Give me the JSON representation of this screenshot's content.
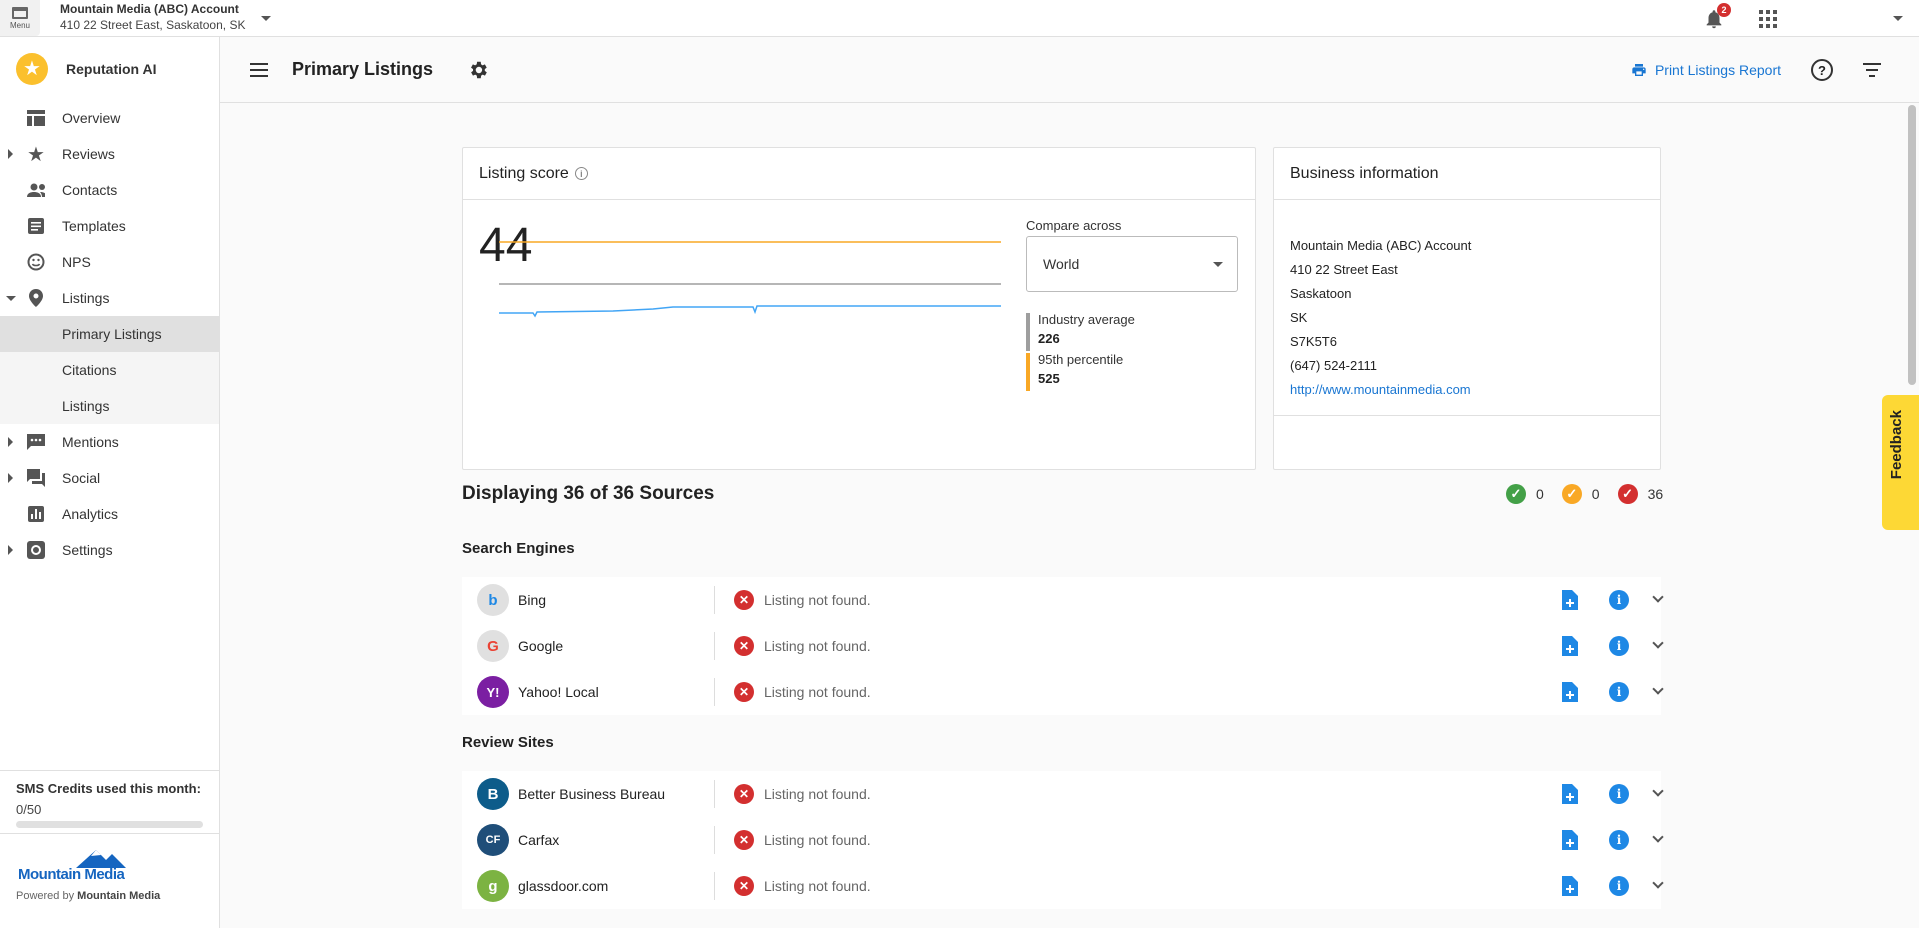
{
  "topbar": {
    "menu_label": "Menu",
    "account_name": "Mountain Media (ABC) Account",
    "account_address": "410 22 Street East, Saskatoon, SK",
    "notification_count": "2"
  },
  "sidebar": {
    "brand": "Reputation AI",
    "items": [
      {
        "label": "Overview",
        "icon": "dashboard-icon"
      },
      {
        "label": "Reviews",
        "icon": "star-icon"
      },
      {
        "label": "Contacts",
        "icon": "people-icon"
      },
      {
        "label": "Templates",
        "icon": "template-icon"
      },
      {
        "label": "NPS",
        "icon": "smiley-icon"
      },
      {
        "label": "Listings",
        "icon": "location-pin-icon"
      },
      {
        "label": "Primary Listings"
      },
      {
        "label": "Citations"
      },
      {
        "label": "Listings"
      },
      {
        "label": "Mentions",
        "icon": "chat-icon"
      },
      {
        "label": "Social",
        "icon": "forum-icon"
      },
      {
        "label": "Analytics",
        "icon": "bar-chart-icon"
      },
      {
        "label": "Settings",
        "icon": "settings-icon"
      }
    ],
    "sms_title": "SMS Credits used this month:",
    "sms_value": "0/50",
    "sms_fraction": 0,
    "footer_logo": "Mountain Media",
    "powered_prefix": "Powered by",
    "powered_brand": "Mountain Media"
  },
  "header": {
    "title": "Primary Listings",
    "print_label": "Print Listings Report"
  },
  "listing_score": {
    "title": "Listing score",
    "score": "44",
    "compare_label": "Compare across",
    "compare_value": "World",
    "legend": [
      {
        "name": "Industry average",
        "value": "226",
        "color": "#9e9e9e"
      },
      {
        "name": "95th percentile",
        "value": "525",
        "color": "#f9a825"
      }
    ]
  },
  "business": {
    "title": "Business information",
    "name": "Mountain Media (ABC) Account",
    "street": "410 22 Street East",
    "city": "Saskatoon",
    "province": "SK",
    "postal": "S7K5T6",
    "phone": "(647) 524-2111",
    "website": "http://www.mountainmedia.com"
  },
  "summary": {
    "displaying": "Displaying 36 of 36 Sources",
    "green_count": "0",
    "yellow_count": "0",
    "red_count": "36"
  },
  "sections": [
    {
      "title": "Search Engines",
      "rows": [
        {
          "name": "Bing",
          "status": "Listing not found.",
          "logo_letter": "b",
          "logo_color": "#e0e0e0",
          "logo_text_color": "#1e88e5"
        },
        {
          "name": "Google",
          "status": "Listing not found.",
          "logo_letter": "G",
          "logo_color": "#e0e0e0",
          "logo_text_color": "#ea4335"
        },
        {
          "name": "Yahoo! Local",
          "status": "Listing not found.",
          "logo_letter": "Y!",
          "logo_color": "#7b1fa2",
          "logo_text_color": "#ffffff"
        }
      ]
    },
    {
      "title": "Review Sites",
      "rows": [
        {
          "name": "Better Business Bureau",
          "status": "Listing not found.",
          "logo_letter": "B",
          "logo_color": "#0d5c8a",
          "logo_text_color": "#ffffff"
        },
        {
          "name": "Carfax",
          "status": "Listing not found.",
          "logo_letter": "CF",
          "logo_color": "#1f4e79",
          "logo_text_color": "#ffffff"
        },
        {
          "name": "glassdoor.com",
          "status": "Listing not found.",
          "logo_letter": "g",
          "logo_color": "#7cb342",
          "logo_text_color": "#ffffff"
        }
      ]
    }
  ],
  "feedback_label": "Feedback"
}
